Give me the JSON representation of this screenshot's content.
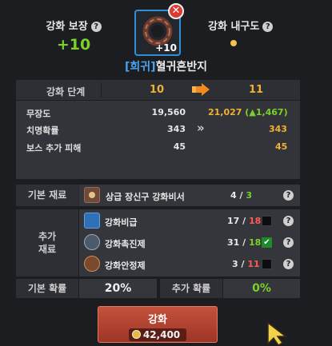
{
  "header": {
    "guarantee_label": "강화 보장",
    "guarantee_value": "+10",
    "durability_label": "강화 내구도",
    "item_level_badge": "+10",
    "item_name_prefix": "[희귀]",
    "item_name": "혈귀혼반지"
  },
  "level_row": {
    "label": "강화 단계",
    "from": "10",
    "to": "11"
  },
  "stats": [
    {
      "name": "무장도",
      "current": "19,560",
      "next": "21,027",
      "diff": "(▲1,467)"
    },
    {
      "name": "치명확률",
      "current": "343",
      "next": "343",
      "diff": ""
    },
    {
      "name": "보스 추가 피해",
      "current": "45",
      "next": "45",
      "diff": ""
    }
  ],
  "base_material": {
    "section_label": "기본 재료",
    "name": "상급 장신구 강화비서",
    "have": "4",
    "need": "3"
  },
  "extra_materials": {
    "section_label": "추가\n재료",
    "items": [
      {
        "name": "강화비급",
        "have": "17",
        "need": "18",
        "checked": false,
        "icon": "book-icon"
      },
      {
        "name": "강화촉진제",
        "have": "31",
        "need": "18",
        "checked": true,
        "icon": "bowl-icon"
      },
      {
        "name": "강화안정제",
        "have": "3",
        "need": "11",
        "checked": false,
        "icon": "bowl-icon"
      }
    ]
  },
  "rates": {
    "base_label": "기본 확률",
    "base_value": "20%",
    "extra_label": "추가 확률",
    "extra_value": "0%"
  },
  "enhance_button": {
    "label": "강화",
    "cost": "42,400"
  },
  "colors": {
    "accent_green": "#7ad12a",
    "accent_orange": "#f0b234",
    "accent_red": "#ff5a55",
    "button_red": "#b3412e",
    "item_frame_blue": "#2f8fd8"
  }
}
